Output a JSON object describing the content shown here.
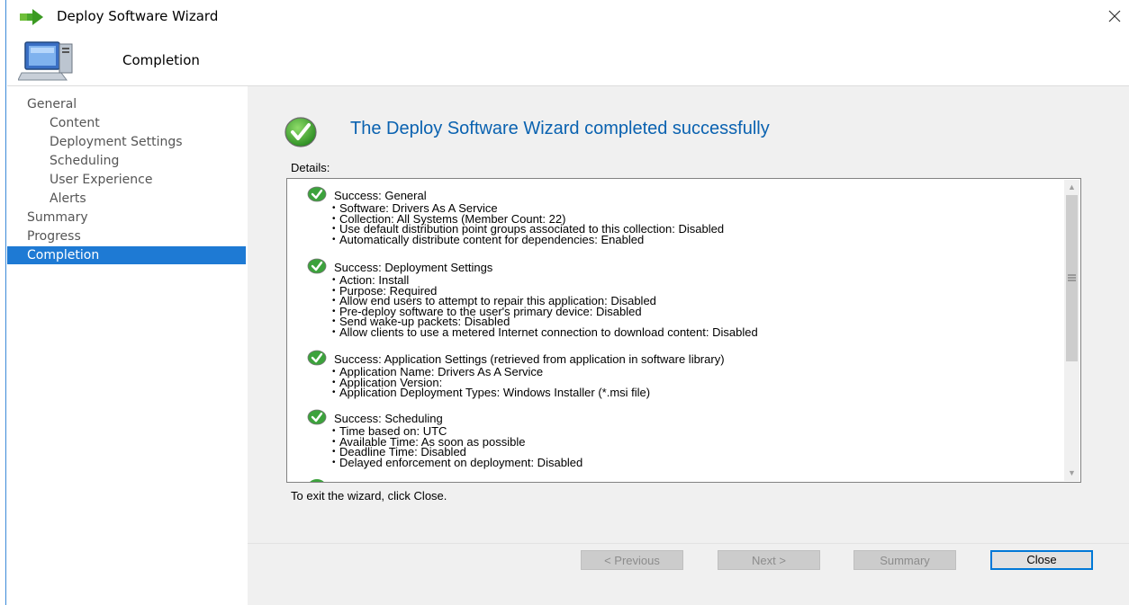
{
  "window": {
    "title": "Deploy Software Wizard"
  },
  "header": {
    "title": "Completion"
  },
  "sidebar": {
    "items": [
      {
        "label": "General",
        "indent": false,
        "active": false
      },
      {
        "label": "Content",
        "indent": true,
        "active": false
      },
      {
        "label": "Deployment Settings",
        "indent": true,
        "active": false
      },
      {
        "label": "Scheduling",
        "indent": true,
        "active": false
      },
      {
        "label": "User Experience",
        "indent": true,
        "active": false
      },
      {
        "label": "Alerts",
        "indent": true,
        "active": false
      },
      {
        "label": "Summary",
        "indent": false,
        "active": false
      },
      {
        "label": "Progress",
        "indent": false,
        "active": false
      },
      {
        "label": "Completion",
        "indent": false,
        "active": true
      }
    ]
  },
  "main": {
    "heading": "The Deploy Software Wizard completed successfully",
    "details_label": "Details:",
    "exit_text": "To exit the wizard, click Close.",
    "sections": [
      {
        "title": "Success: General",
        "lines": [
          "Software: Drivers As A Service",
          "Collection: All Systems (Member Count: 22)",
          "Use default distribution point groups associated to this collection: Disabled",
          "Automatically distribute content for dependencies: Enabled"
        ]
      },
      {
        "title": "Success: Deployment Settings",
        "lines": [
          "Action: Install",
          "Purpose: Required",
          "Allow end users to attempt to repair this application: Disabled",
          "Pre-deploy software to the user's primary device: Disabled",
          "Send wake-up packets: Disabled",
          "Allow clients to use a metered Internet connection to download content: Disabled"
        ]
      },
      {
        "title": "Success: Application Settings (retrieved from application in software library)",
        "lines": [
          "Application Name: Drivers As A Service",
          "Application Version:",
          "Application Deployment Types: Windows Installer (*.msi file)"
        ]
      },
      {
        "title": "Success: Scheduling",
        "lines": [
          "Time based on: UTC",
          "Available Time: As soon as possible",
          "Deadline Time: Disabled",
          "Delayed enforcement on deployment: Disabled"
        ]
      }
    ]
  },
  "buttons": {
    "previous": "< Previous",
    "next": "Next >",
    "summary": "Summary",
    "close": "Close"
  },
  "colors": {
    "accent": "#1e7ad4",
    "heading": "#0a62b0",
    "success_green": "#3ca23c"
  }
}
